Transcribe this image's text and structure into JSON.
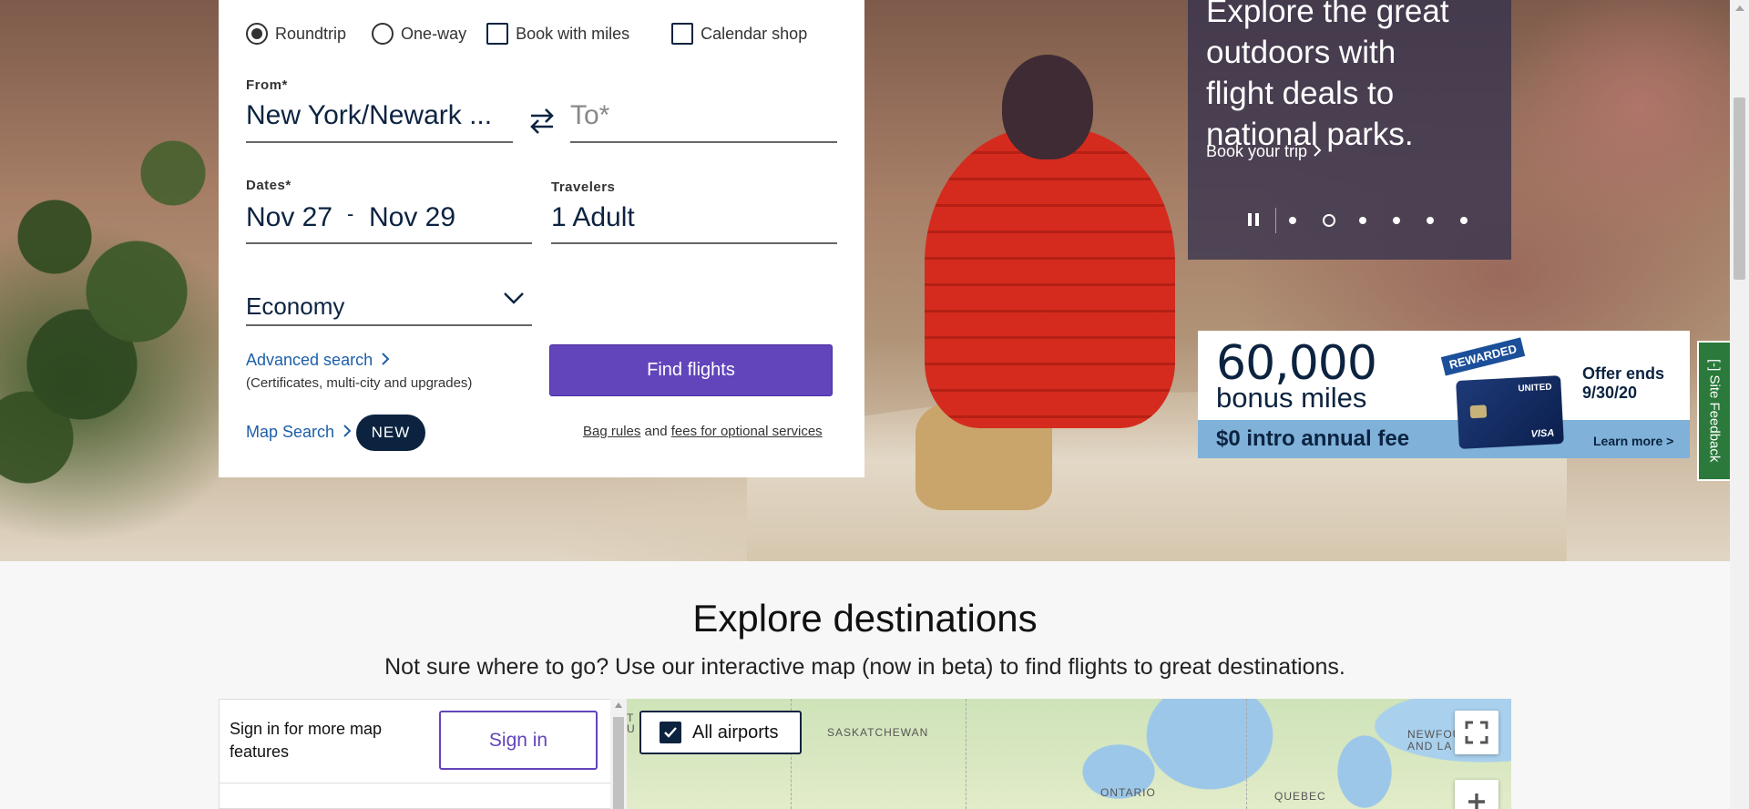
{
  "hero": {
    "promo": {
      "headline_lines": [
        "Explore the great",
        "outdoors with",
        "flight deals to",
        "national parks."
      ],
      "link": "Book your trip",
      "slide_count": 6,
      "active_slide": 2
    },
    "ad": {
      "rewarded": "REWARDED",
      "miles": "60,000",
      "bonus": "bonus miles",
      "fee": "$0 intro annual fee",
      "offer_line1": "Offer ends",
      "offer_line2": "9/30/20",
      "learn_more": "Learn more >",
      "card_brand": "UNITED",
      "card_network": "VISA"
    },
    "site_feedback": "[-] Site Feedback"
  },
  "booking": {
    "trip_types": {
      "roundtrip": "Roundtrip",
      "oneway": "One-way",
      "book_with_miles": "Book with miles",
      "calendar_shop": "Calendar shop"
    },
    "from_label": "From*",
    "from_value": "New York/Newark ...",
    "to_placeholder": "To*",
    "dates_label": "Dates*",
    "date_start": "Nov 27",
    "date_sep": "-",
    "date_end": "Nov 29",
    "travelers_label": "Travelers",
    "travelers_value": "1 Adult",
    "cabin_value": "Economy",
    "advanced_search": "Advanced search",
    "advanced_sub": "(Certificates, multi-city and upgrades)",
    "find_flights": "Find flights",
    "map_search": "Map Search",
    "new_badge": "NEW",
    "bag_rules": "Bag rules",
    "and": "and",
    "fees": "fees for optional services"
  },
  "explore": {
    "title": "Explore destinations",
    "subtitle": "Not sure where to go? Use our interactive map (now in beta) to find flights to great destinations.",
    "signin_text": "Sign in for more map features",
    "signin_button": "Sign in",
    "all_airports": "All airports",
    "map_labels": {
      "saskatchewan": "SASKATCHEWAN",
      "ontario": "ONTARIO",
      "quebec": "QUEBEC",
      "newfoundland_1": "NEWFOUI",
      "newfoundland_2": "AND LA",
      "edge": "T",
      "edge2": "U"
    }
  },
  "colors": {
    "primary_purple": "#6244bb",
    "navy": "#0c2340",
    "link_blue": "#1e5fa8",
    "feedback_green": "#2b7a3b"
  }
}
